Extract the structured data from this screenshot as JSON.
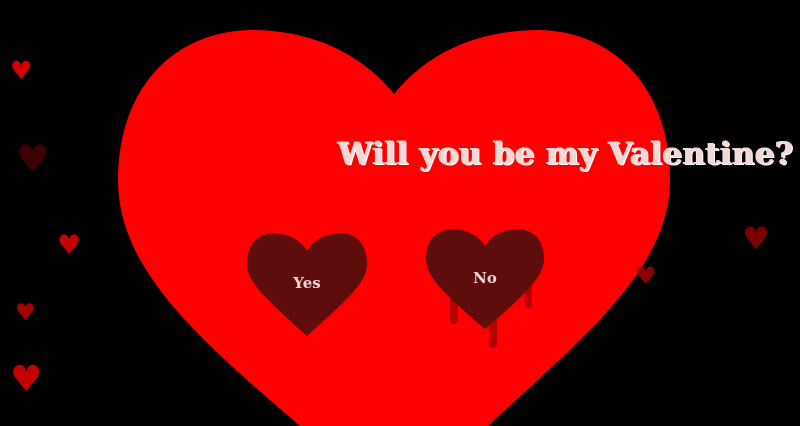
{
  "page": {
    "question": "Will you be my Valentine?",
    "yes_label": "Yes",
    "no_label": "No"
  },
  "colors": {
    "background": "#000000",
    "big_heart": "#ff0000",
    "button_heart": "#5e0d0d",
    "drip": "#b30000",
    "title_text": "#f3d8d8",
    "button_text": "#f1d6d6"
  },
  "decor": {
    "floating_heart_glyph": "♥"
  }
}
